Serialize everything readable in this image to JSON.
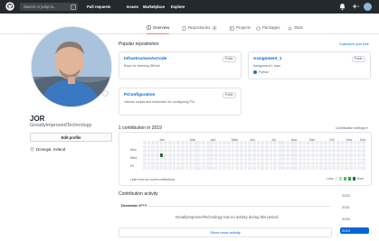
{
  "topbar": {
    "search_placeholder": "Search or jump to...",
    "search_key": "/",
    "nav": [
      "Pull requests",
      "Issues",
      "Marketplace",
      "Explore"
    ]
  },
  "tabs": [
    {
      "label": "Overview",
      "icon": "book-icon",
      "active": true
    },
    {
      "label": "Repositories",
      "icon": "repo-icon",
      "count": "2"
    },
    {
      "label": "Projects",
      "icon": "project-icon"
    },
    {
      "label": "Packages",
      "icon": "package-icon"
    },
    {
      "label": "Stars",
      "icon": "star-icon"
    }
  ],
  "profile": {
    "name": "JOR",
    "login": "GreatlyImprovedTechnology",
    "edit_label": "Edit profile",
    "location": "Donegal, Ireland"
  },
  "popular": {
    "title": "Popular repositories",
    "customize": "Customize your pins",
    "repos": [
      {
        "name": "InfrastructureAsCode",
        "desc": "Repo for learning GitHub",
        "visibility": "Public",
        "lang": ""
      },
      {
        "name": "Assignment_1",
        "desc": "Assignment 1 repo",
        "visibility": "Public",
        "lang": "Python"
      },
      {
        "name": "PiConfiguration",
        "desc": "Various scripts and instruction for configuring Pi's",
        "visibility": "Public",
        "lang": ""
      }
    ]
  },
  "contributions": {
    "title": "1 contribution in 2019",
    "settings": "Contribution settings ▾",
    "months": [
      "Jan",
      "Mar",
      "Apr",
      "May",
      "Jun",
      "Jul",
      "Aug",
      "Sep",
      "Oct",
      "Nov",
      "Dec"
    ],
    "days": [
      "Mon",
      "Wed",
      "Fri"
    ],
    "learn": "Learn how we count contributions",
    "less": "Less",
    "more": "More",
    "active_cells": [
      [
        4,
        3
      ]
    ]
  },
  "activity": {
    "title": "Contribution activity",
    "month": "December 2019",
    "message": "GreatlyImprovedTechnology has no activity during this period.",
    "show_more": "Show more activity"
  },
  "years": [
    "2022",
    "2021",
    "2020",
    "2019"
  ],
  "active_year": "2019",
  "colors": {
    "accent": "#0366d6",
    "tab_underline": "#f9826c",
    "python": "#3572A5",
    "contrib_on": "#216e39"
  }
}
